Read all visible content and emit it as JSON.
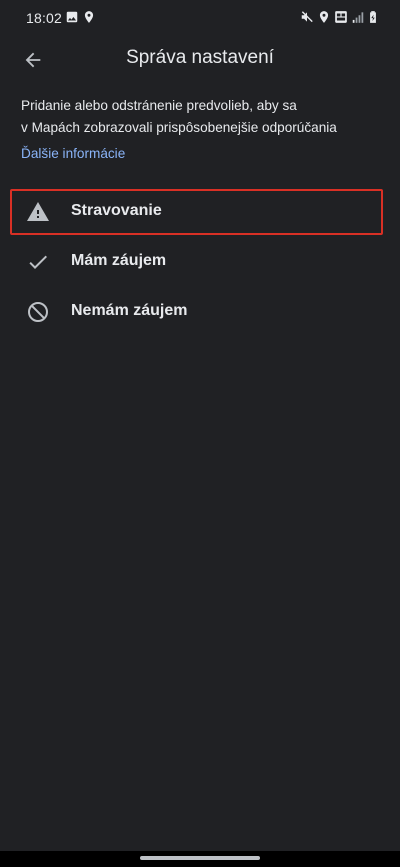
{
  "status_bar": {
    "time": "18:02",
    "icons_left": [
      "image-icon",
      "location-pin-icon"
    ],
    "icons_right": [
      "mute-icon",
      "location-pin-icon",
      "volte-icon",
      "signal-icon",
      "battery-icon"
    ]
  },
  "app_bar": {
    "title": "Správa nastavení",
    "back_icon": "arrow-back-icon"
  },
  "description": {
    "line1": "Pridanie alebo odstránenie predvolieb, aby sa",
    "line2": "v Mapách zobrazovali prispôsobenejšie odporúčania"
  },
  "more_info_link": "Ďalšie informácie",
  "options": [
    {
      "label": "Stravovanie",
      "icon": "warning-icon",
      "selected": true
    },
    {
      "label": "Mám záujem",
      "icon": "check-icon",
      "selected": false
    },
    {
      "label": "Nemám záujem",
      "icon": "block-icon",
      "selected": false
    }
  ],
  "colors": {
    "background": "#202124",
    "text": "#e8eaed",
    "link": "#8ab4f8",
    "selection_border": "#d93025",
    "icon": "#bdc1c6"
  }
}
